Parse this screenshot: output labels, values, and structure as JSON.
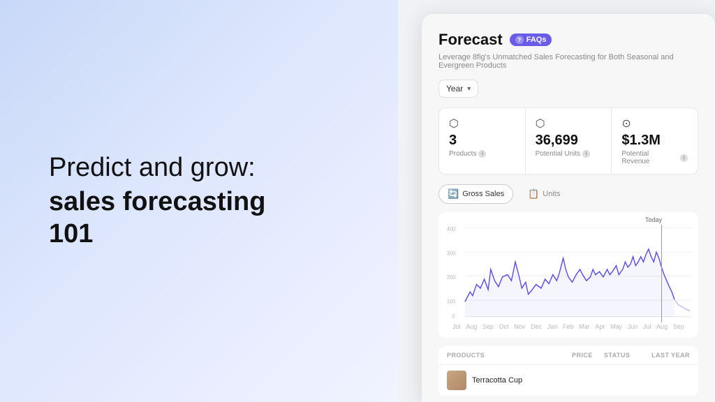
{
  "left": {
    "subtitle": "Predict and grow:",
    "title": "sales forecasting 101"
  },
  "dashboard": {
    "title": "Forecast",
    "faq_label": "FAQs",
    "subtitle": "Leverage 8fig's Unmatched Sales Forecasting for Both Seasonal and Evergreen Products",
    "dropdown": {
      "label": "Year"
    },
    "stats": [
      {
        "icon": "📦",
        "value": "3",
        "label": "Products",
        "info": "i"
      },
      {
        "icon": "📦",
        "value": "36,699",
        "label": "Potential Units",
        "info": "i"
      },
      {
        "icon": "💰",
        "value": "$1.3M",
        "label": "Potential Revenue",
        "info": "i"
      }
    ],
    "toggles": [
      {
        "label": "Gross Sales",
        "active": true,
        "icon": "🔄"
      },
      {
        "label": "Units",
        "active": false,
        "icon": "📋"
      }
    ],
    "chart": {
      "y_labels": [
        "400",
        "300",
        "200",
        "100",
        "0"
      ],
      "x_labels": [
        "Jul",
        "Aug",
        "Sep",
        "Oct",
        "Nov",
        "Dec",
        "Jan",
        "Feb",
        "Mar",
        "Apr",
        "May",
        "Jun",
        "Jul",
        "Aug",
        "Sep"
      ],
      "today_label": "Today"
    },
    "table": {
      "headers": {
        "product": "PRODUCTS",
        "price": "PRICE",
        "status": "STATUS",
        "last_year": "LAST YEAR"
      },
      "rows": [
        {
          "name": "Terracotta Cup",
          "color": "#c8a882"
        }
      ]
    }
  }
}
